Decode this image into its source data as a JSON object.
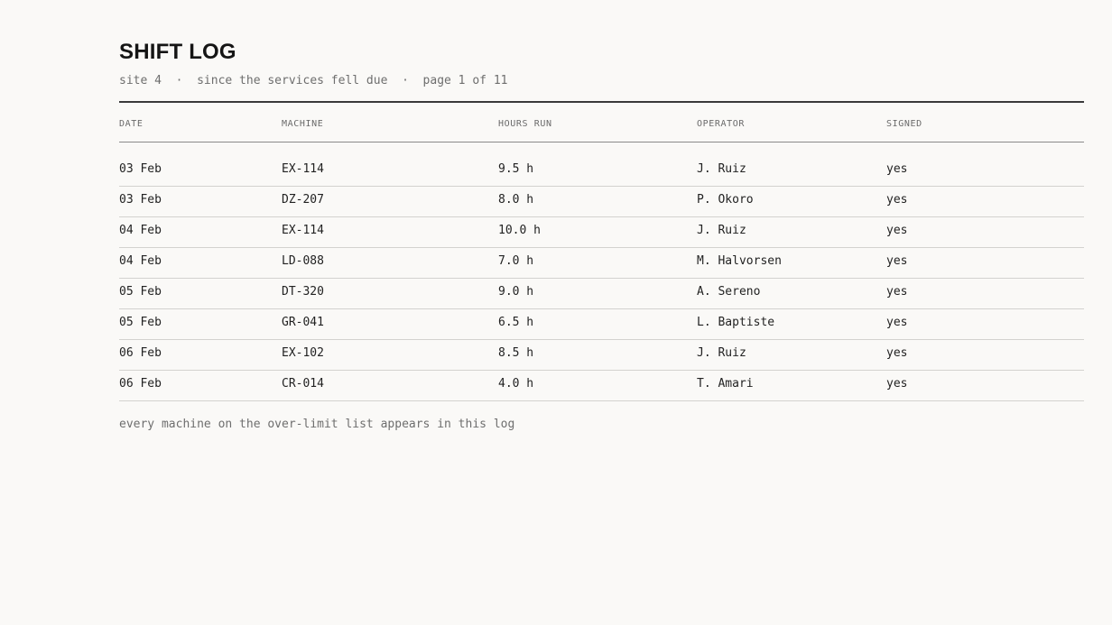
{
  "header": {
    "title": "SHIFT LOG",
    "subtitle": "site 4  ·  since the services fell due  ·  page 1 of 11"
  },
  "table": {
    "columns": [
      "DATE",
      "MACHINE",
      "HOURS RUN",
      "OPERATOR",
      "SIGNED"
    ],
    "rows": [
      [
        "03 Feb",
        "EX-114",
        "9.5 h",
        "J. Ruiz",
        "yes"
      ],
      [
        "03 Feb",
        "DZ-207",
        "8.0 h",
        "P. Okoro",
        "yes"
      ],
      [
        "04 Feb",
        "EX-114",
        "10.0 h",
        "J. Ruiz",
        "yes"
      ],
      [
        "04 Feb",
        "LD-088",
        "7.0 h",
        "M. Halvorsen",
        "yes"
      ],
      [
        "05 Feb",
        "DT-320",
        "9.0 h",
        "A. Sereno",
        "yes"
      ],
      [
        "05 Feb",
        "GR-041",
        "6.5 h",
        "L. Baptiste",
        "yes"
      ],
      [
        "06 Feb",
        "EX-102",
        "8.5 h",
        "J. Ruiz",
        "yes"
      ],
      [
        "06 Feb",
        "CR-014",
        "4.0 h",
        "T. Amari",
        "yes"
      ]
    ]
  },
  "footer": {
    "note": "every machine on the over-limit list appears in this log"
  }
}
